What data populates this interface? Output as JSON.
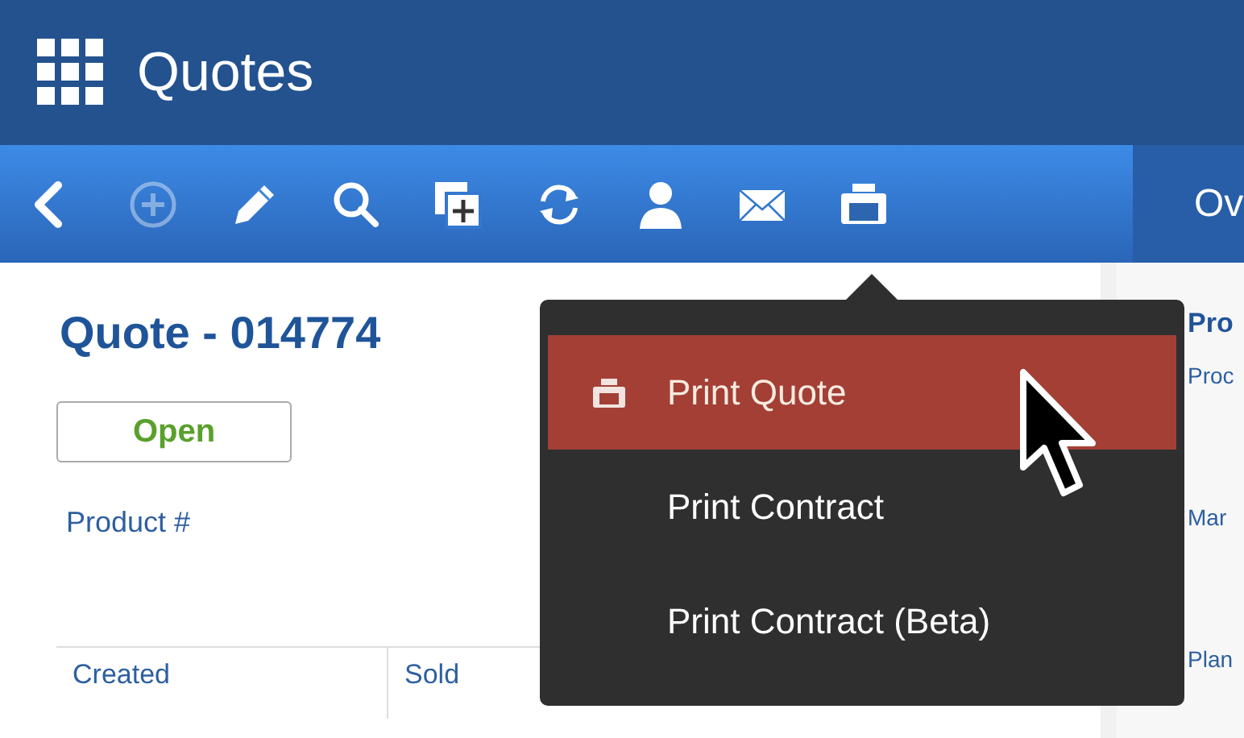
{
  "header": {
    "title": "Quotes"
  },
  "toolbar": {
    "buttons": [
      {
        "kind": "back",
        "disabled": false
      },
      {
        "kind": "add",
        "disabled": true
      },
      {
        "kind": "edit",
        "disabled": false
      },
      {
        "kind": "search",
        "disabled": false
      },
      {
        "kind": "duplicate",
        "disabled": false
      },
      {
        "kind": "refresh",
        "disabled": false
      },
      {
        "kind": "contact",
        "disabled": false
      },
      {
        "kind": "email",
        "disabled": false
      },
      {
        "kind": "print",
        "disabled": false
      }
    ],
    "right_label": "Ov"
  },
  "record": {
    "title": "Quote - 014774",
    "status": "Open",
    "field_label": "Product #",
    "columns": [
      "Created",
      "Sold"
    ]
  },
  "side_panel": {
    "heading": "Pro",
    "labels": [
      "Proc",
      "Mar",
      "Plan"
    ]
  },
  "print_menu": {
    "items": [
      {
        "label": "Print Quote",
        "selected": true
      },
      {
        "label": "Print Contract",
        "selected": false
      },
      {
        "label": "Print Contract (Beta)",
        "selected": false
      }
    ]
  }
}
